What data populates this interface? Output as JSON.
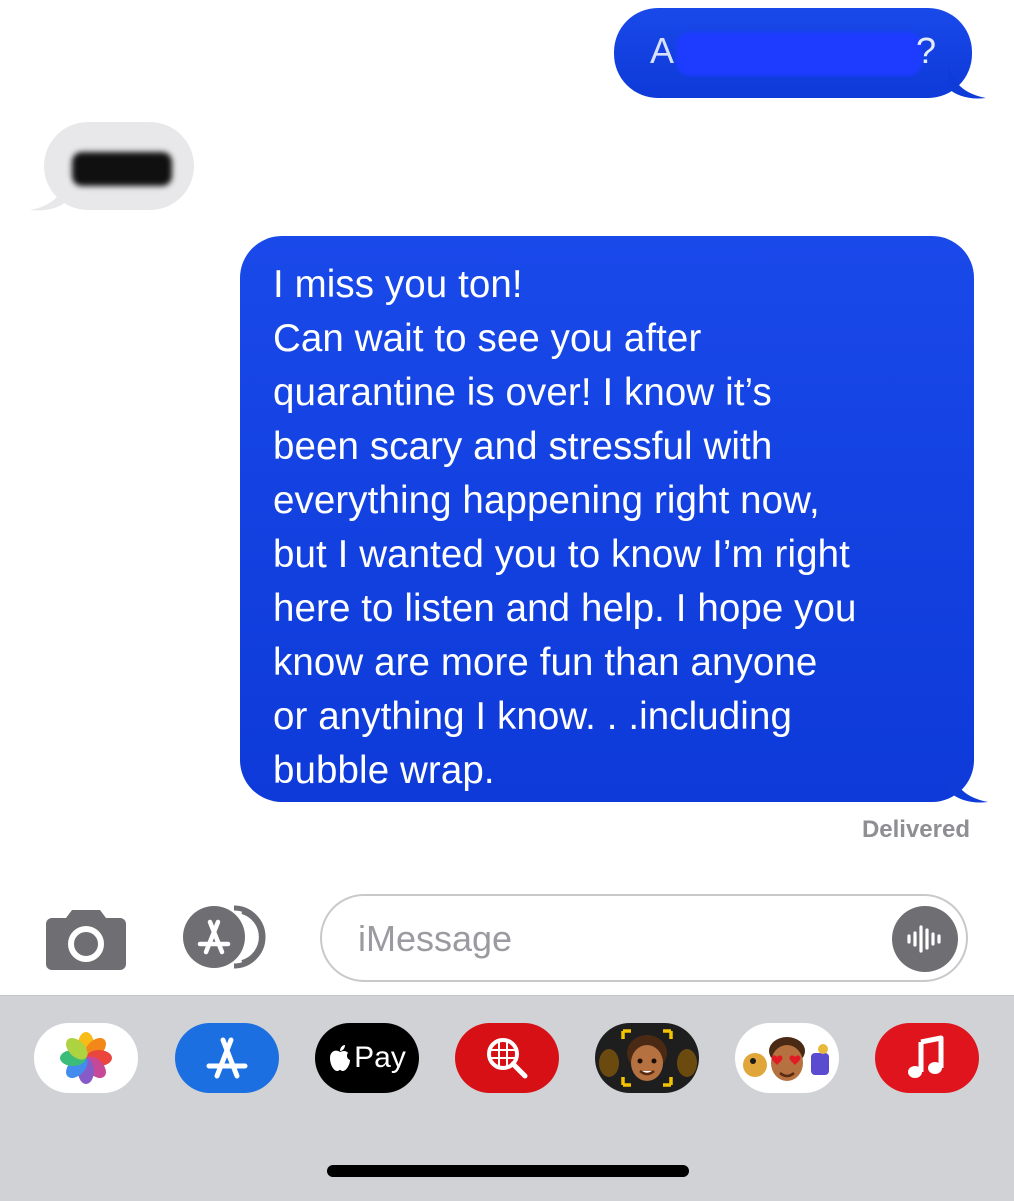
{
  "thread": {
    "message_1": {
      "start": "A",
      "end": "?"
    },
    "message_3": {
      "text": "I miss you ton!\nCan wait to see you after\nquarantine is over! I know it’s\nbeen scary and stressful with\neverything happening right now,\nbut I wanted you to know I’m right\nhere to listen and help. I hope you\nknow are more fun than anyone\nor anything I know. . .including\nbubble wrap."
    },
    "status": "Delivered"
  },
  "composer": {
    "placeholder": "iMessage"
  },
  "drawer": {
    "apps": [
      {
        "name": "photos-app",
        "icon": "photos-flower-icon"
      },
      {
        "name": "app-store-app",
        "icon": "app-store-icon"
      },
      {
        "name": "apple-pay-app",
        "label": "Pay",
        "icon": "apple-logo-icon"
      },
      {
        "name": "search-images-app",
        "icon": "magnifier-globe-icon"
      },
      {
        "name": "memoji-app",
        "icon": "memoji-face-icon"
      },
      {
        "name": "memoji-stickers-app",
        "icon": "memoji-stickers-icon"
      },
      {
        "name": "music-app",
        "icon": "music-note-icon"
      }
    ]
  },
  "colors": {
    "outgoing_bubble": "#1a49ea",
    "incoming_bubble": "#e8e8ea",
    "drawer_bg": "#d1d2d6",
    "status_text": "#8e8e93"
  }
}
